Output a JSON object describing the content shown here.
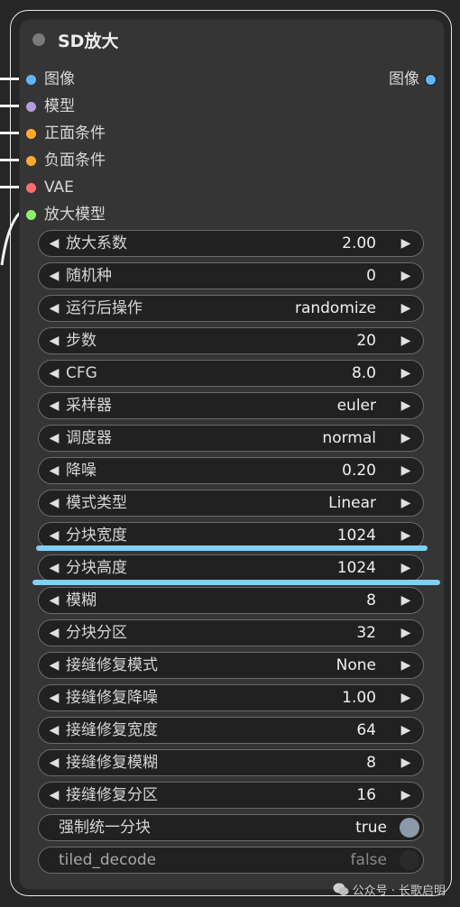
{
  "node": {
    "title": "SD放大",
    "inputs": [
      {
        "label": "图像",
        "color": "#64b5f6"
      },
      {
        "label": "模型",
        "color": "#b39ddb"
      },
      {
        "label": "正面条件",
        "color": "#ffa931"
      },
      {
        "label": "负面条件",
        "color": "#ffa931"
      },
      {
        "label": "VAE",
        "color": "#ff6e6e"
      },
      {
        "label": "放大模型",
        "color": "#8ef06e"
      }
    ],
    "output": {
      "label": "图像",
      "color": "#64b5f6"
    },
    "widgets": [
      {
        "name": "放大系数",
        "value": "2.00"
      },
      {
        "name": "随机种",
        "value": "0"
      },
      {
        "name": "运行后操作",
        "value": "randomize"
      },
      {
        "name": "步数",
        "value": "20"
      },
      {
        "name": "CFG",
        "value": "8.0"
      },
      {
        "name": "采样器",
        "value": "euler"
      },
      {
        "name": "调度器",
        "value": "normal"
      },
      {
        "name": "降噪",
        "value": "0.20"
      },
      {
        "name": "模式类型",
        "value": "Linear"
      },
      {
        "name": "分块宽度",
        "value": "1024"
      },
      {
        "name": "分块高度",
        "value": "1024"
      },
      {
        "name": "模糊",
        "value": "8"
      },
      {
        "name": "分块分区",
        "value": "32"
      },
      {
        "name": "接缝修复模式",
        "value": "None"
      },
      {
        "name": "接缝修复降噪",
        "value": "1.00"
      },
      {
        "name": "接缝修复宽度",
        "value": "64"
      },
      {
        "name": "接缝修复模糊",
        "value": "8"
      },
      {
        "name": "接缝修复分区",
        "value": "16"
      }
    ],
    "toggles": [
      {
        "name": "强制统一分块",
        "value": "true",
        "on": true
      },
      {
        "name": "tiled_decode",
        "value": "false",
        "on": false
      }
    ],
    "arrow_left": "◀",
    "arrow_right": "▶"
  },
  "colors": {
    "highlight": "#7fd0f6",
    "knob_on": "#8a9aaa",
    "knob_off": "#2a2a2a"
  },
  "watermark": "公众号 · 长歌启明"
}
